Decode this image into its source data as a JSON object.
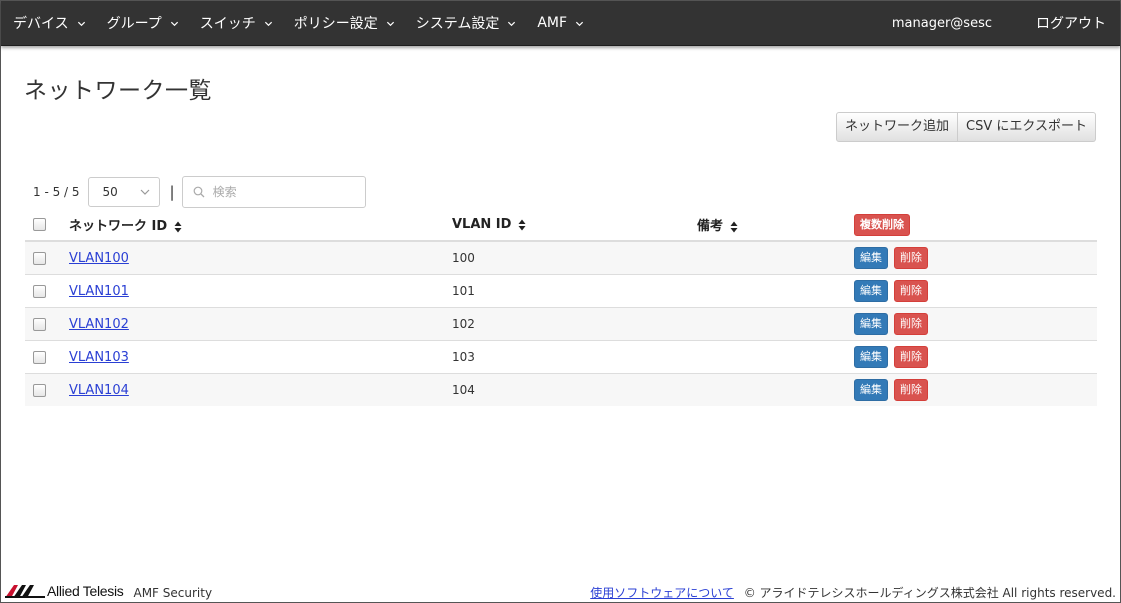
{
  "nav": {
    "items": [
      {
        "label": "デバイス"
      },
      {
        "label": "グループ"
      },
      {
        "label": "スイッチ"
      },
      {
        "label": "ポリシー設定"
      },
      {
        "label": "システム設定"
      },
      {
        "label": "AMF"
      }
    ],
    "user": "manager@sesc",
    "logout": "ログアウト"
  },
  "page": {
    "title": "ネットワーク一覧"
  },
  "actions": {
    "add_network": "ネットワーク追加",
    "export_csv": "CSV にエクスポート"
  },
  "list": {
    "range": "1 - 5 / 5",
    "page_size": "50",
    "search_placeholder": "検索"
  },
  "table": {
    "headers": {
      "network_id": "ネットワーク ID",
      "vlan_id": "VLAN ID",
      "note": "備考",
      "bulk_delete": "複数削除"
    },
    "edit_label": "編集",
    "delete_label": "削除",
    "rows": [
      {
        "network_id": "VLAN100",
        "vlan_id": "100",
        "note": ""
      },
      {
        "network_id": "VLAN101",
        "vlan_id": "101",
        "note": ""
      },
      {
        "network_id": "VLAN102",
        "vlan_id": "102",
        "note": ""
      },
      {
        "network_id": "VLAN103",
        "vlan_id": "103",
        "note": ""
      },
      {
        "network_id": "VLAN104",
        "vlan_id": "104",
        "note": ""
      }
    ]
  },
  "footer": {
    "brand": "Allied Telesis",
    "product": "AMF Security",
    "about_link": "使用ソフトウェアについて",
    "copyright": "© アライドテレシスホールディングス株式会社 All rights reserved."
  },
  "colors": {
    "navbar": "#333333",
    "primary_button": "#337ab7",
    "danger_button": "#d9534f",
    "link": "#2a3fd4",
    "brand_red": "#c8102e"
  }
}
